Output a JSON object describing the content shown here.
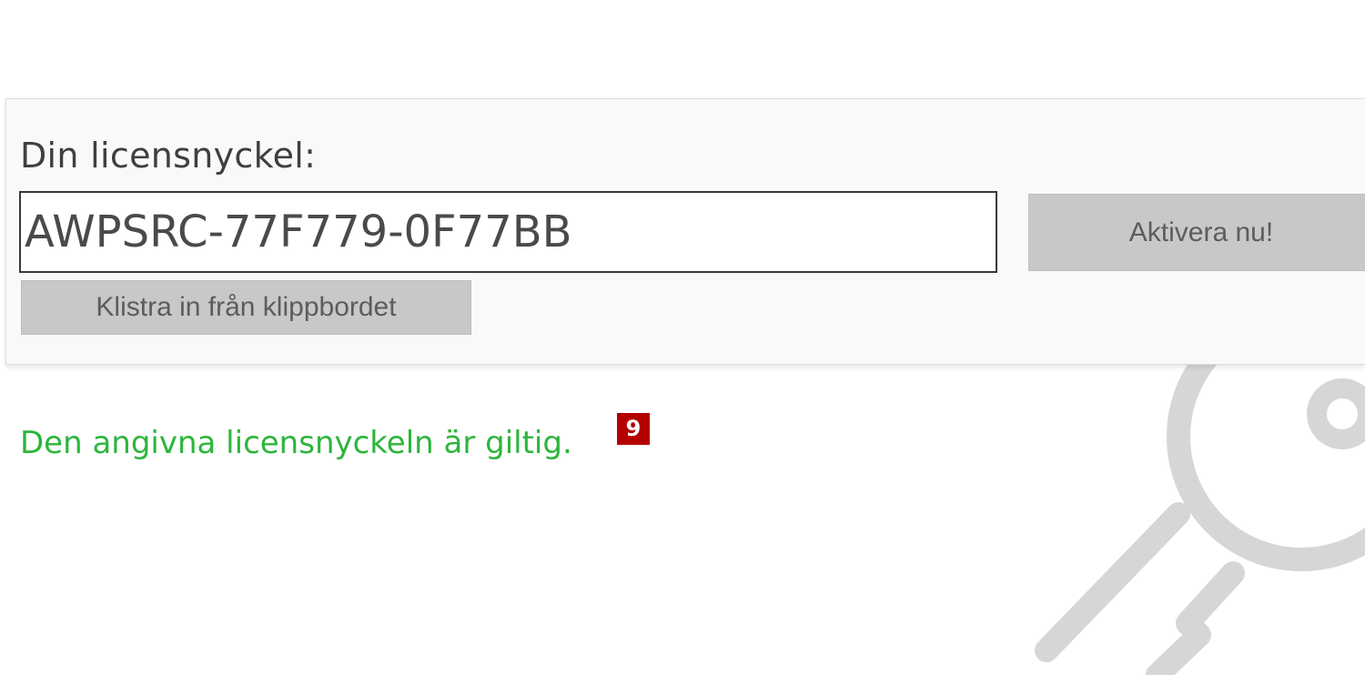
{
  "license": {
    "label": "Din licensnyckel:",
    "key_value": "AWPSRC-77F779-0F77BB"
  },
  "buttons": {
    "activate_label": "Aktivera nu!",
    "paste_label": "Klistra in från klippbordet"
  },
  "status": {
    "message": "Den angivna licensnyckeln är giltig.",
    "badge_number": "9"
  },
  "icons": {
    "watermark": "key-icon"
  },
  "colors": {
    "status_valid": "#2db53c",
    "badge_background": "#b30000",
    "button_background": "#c8c8c8"
  }
}
